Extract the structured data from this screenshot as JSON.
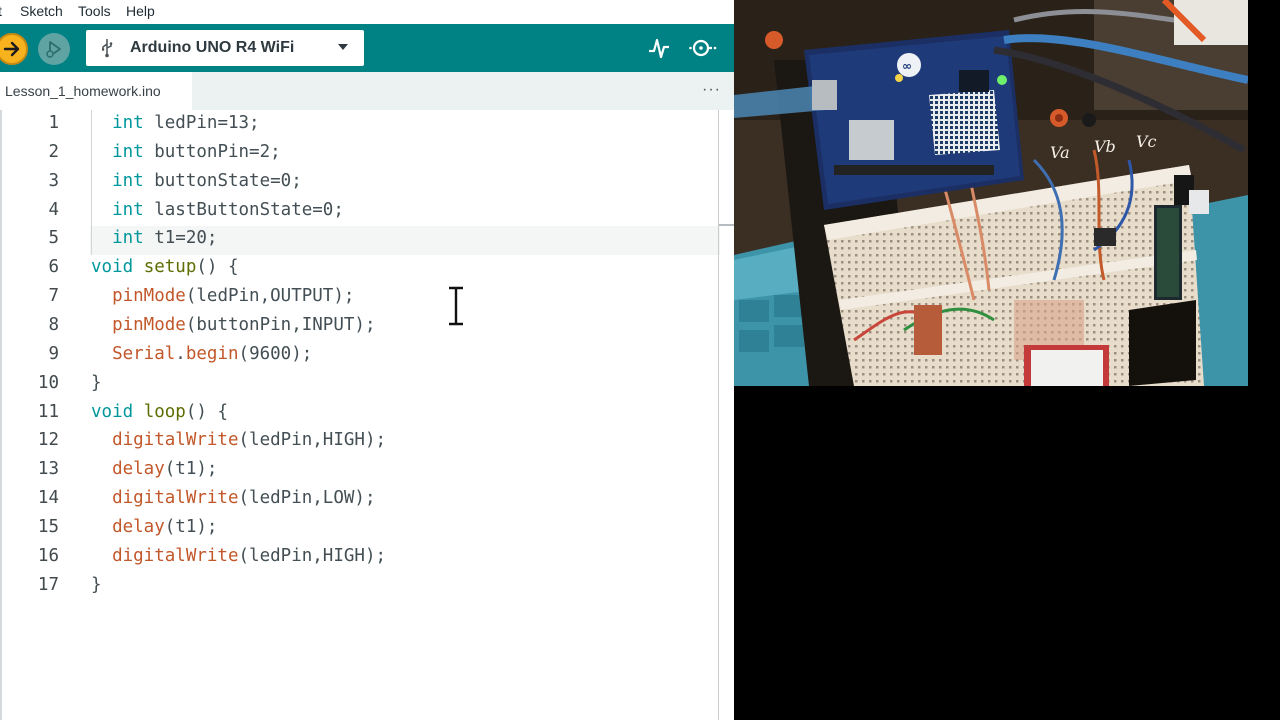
{
  "menu": {
    "items": [
      "t",
      "Sketch",
      "Tools",
      "Help"
    ]
  },
  "toolbar": {
    "board_name": "Arduino UNO R4 WiFi",
    "verify_icon": "arrow-right-icon",
    "upload_icon": "debug-play-icon",
    "plotter_icon": "pulse-icon",
    "monitor_icon": "magnifier-dots-icon",
    "accent_color": "#008184"
  },
  "tabs": {
    "active": "Lesson_1_homework.ino",
    "more": "···"
  },
  "editor": {
    "line_numbers": [
      "1",
      "2",
      "3",
      "4",
      "5",
      "6",
      "7",
      "8",
      "9",
      "10",
      "11",
      "12",
      "13",
      "14",
      "15",
      "16",
      "17"
    ],
    "lines": [
      [
        "  ",
        "int",
        " ledPin=13;"
      ],
      [
        "  ",
        "int",
        " buttonPin=2;"
      ],
      [
        "  ",
        "int",
        " buttonState=0;"
      ],
      [
        "  ",
        "int",
        " lastButtonState=0;"
      ],
      [
        "  ",
        "int",
        " t1=20;"
      ],
      [
        "",
        "void",
        " ",
        "setup",
        "() {"
      ],
      [
        "  ",
        "pinMode",
        "(ledPin,OUTPUT);"
      ],
      [
        "  ",
        "pinMode",
        "(buttonPin,INPUT);"
      ],
      [
        "  ",
        "Serial",
        ".",
        "begin",
        "(9600);"
      ],
      [
        "",
        "}"
      ],
      [
        "",
        "void",
        " ",
        "loop",
        "() {"
      ],
      [
        "  ",
        "digitalWrite",
        "(ledPin,HIGH);"
      ],
      [
        "  ",
        "delay",
        "(t1);"
      ],
      [
        "  ",
        "digitalWrite",
        "(ledPin,LOW);"
      ],
      [
        "  ",
        "delay",
        "(t1);"
      ],
      [
        "  ",
        "digitalWrite",
        "(ledPin,HIGH);"
      ],
      [
        "",
        "}"
      ]
    ],
    "current_line": 5,
    "text_cursor_icon": "i-beam-cursor-icon"
  },
  "camera": {
    "label_a": "Va",
    "label_b": "Vb",
    "label_c": "Vc"
  }
}
